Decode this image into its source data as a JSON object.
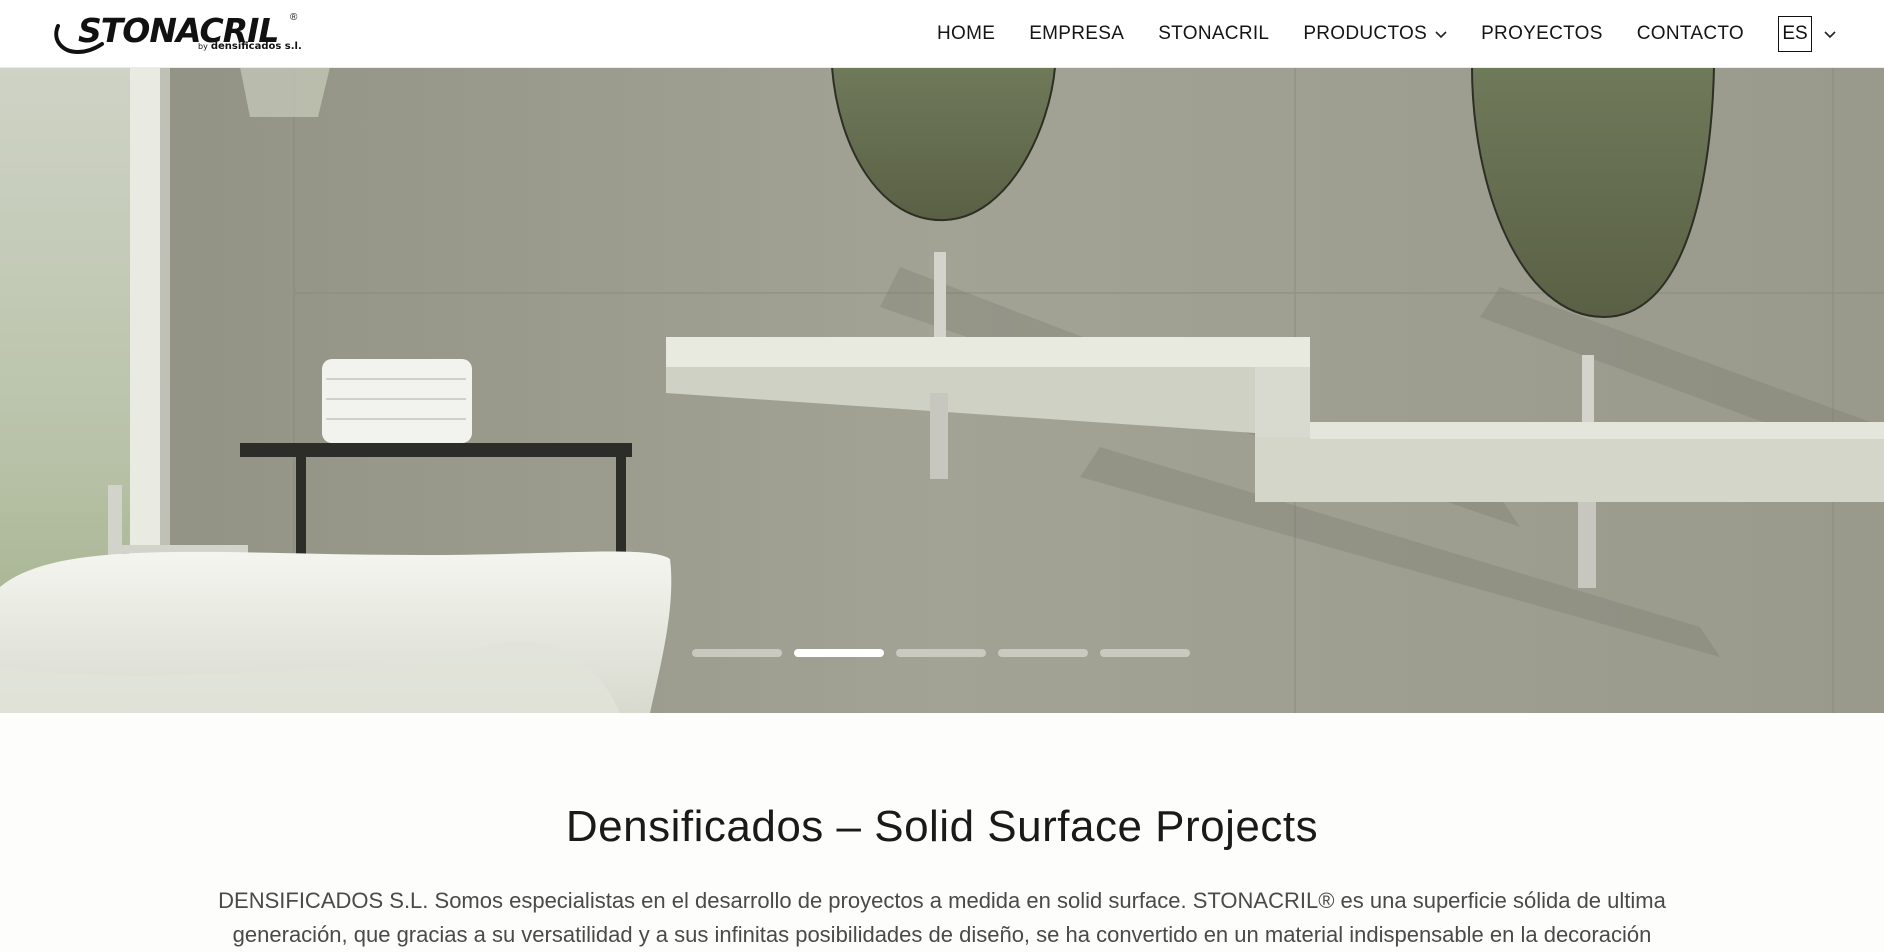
{
  "brand": {
    "logo_text": "STONACRIL",
    "logo_registered": "®",
    "logo_by": "by",
    "logo_company": "densificados s.l."
  },
  "nav": {
    "items": [
      {
        "label": "HOME"
      },
      {
        "label": "EMPRESA"
      },
      {
        "label": "STONACRIL"
      },
      {
        "label": "PRODUCTOS",
        "has_dropdown": true
      },
      {
        "label": "PROYECTOS"
      },
      {
        "label": "CONTACTO"
      }
    ],
    "language": "ES"
  },
  "hero": {
    "slide_count": 5,
    "active_slide": 2
  },
  "intro": {
    "title": "Densificados – Solid Surface Projects",
    "text": "DENSIFICADOS S.L. Somos especialistas en el desarrollo de proyectos a medida en solid surface. STONACRIL® es una superficie sólida de ultima generación, que gracias a su versatilidad y a sus infinitas posibilidades de diseño, se ha convertido en un material indispensable en la decoración"
  },
  "colors": {
    "hero_wall": "#9a9a8b",
    "hero_surface": "#d9dbd0",
    "header_bg": "#ffffff",
    "text_dark": "#1a1a1a"
  }
}
